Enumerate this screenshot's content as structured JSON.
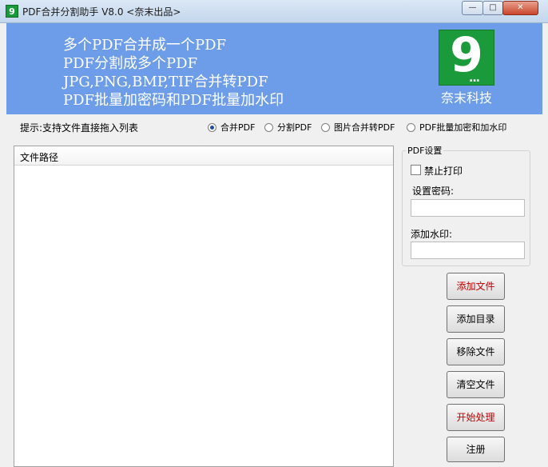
{
  "window": {
    "title": "PDF合并分割助手 V8.0 <奈末出品>",
    "icon_name": "app-logo-icon",
    "controls": {
      "minimize": "—",
      "maximize": "□",
      "close": "✕"
    }
  },
  "banner": {
    "lines": [
      "多个PDF合并成一个PDF",
      "PDF分割成多个PDF",
      "JPG,PNG,BMP,TIF合并转PDF",
      "PDF批量加密码和PDF批量加水印"
    ],
    "logo_glyph": "9",
    "logo_dots": "...",
    "logo_caption": "奈末科技",
    "background_color": "#6d9de8",
    "logo_color": "#1a9a3a"
  },
  "hint": "提示:支持文件直接拖入列表",
  "modes": [
    {
      "label": "合并PDF",
      "checked": true
    },
    {
      "label": "分割PDF",
      "checked": false
    },
    {
      "label": "图片合并转PDF",
      "checked": false
    },
    {
      "label": "PDF批量加密和加水印",
      "checked": false
    }
  ],
  "file_list": {
    "header": "文件路径",
    "rows": []
  },
  "pdf_settings": {
    "title": "PDF设置",
    "disable_print_label": "禁止打印",
    "disable_print_checked": false,
    "password_label": "设置密码:",
    "password_value": "",
    "watermark_label": "添加水印:",
    "watermark_value": ""
  },
  "buttons": {
    "add_file": "添加文件",
    "add_folder": "添加目录",
    "remove_file": "移除文件",
    "clear_files": "清空文件",
    "start": "开始处理",
    "register": "注册"
  },
  "colors": {
    "accent_red": "#c00000",
    "radio_checked": "#1f4f9a"
  }
}
